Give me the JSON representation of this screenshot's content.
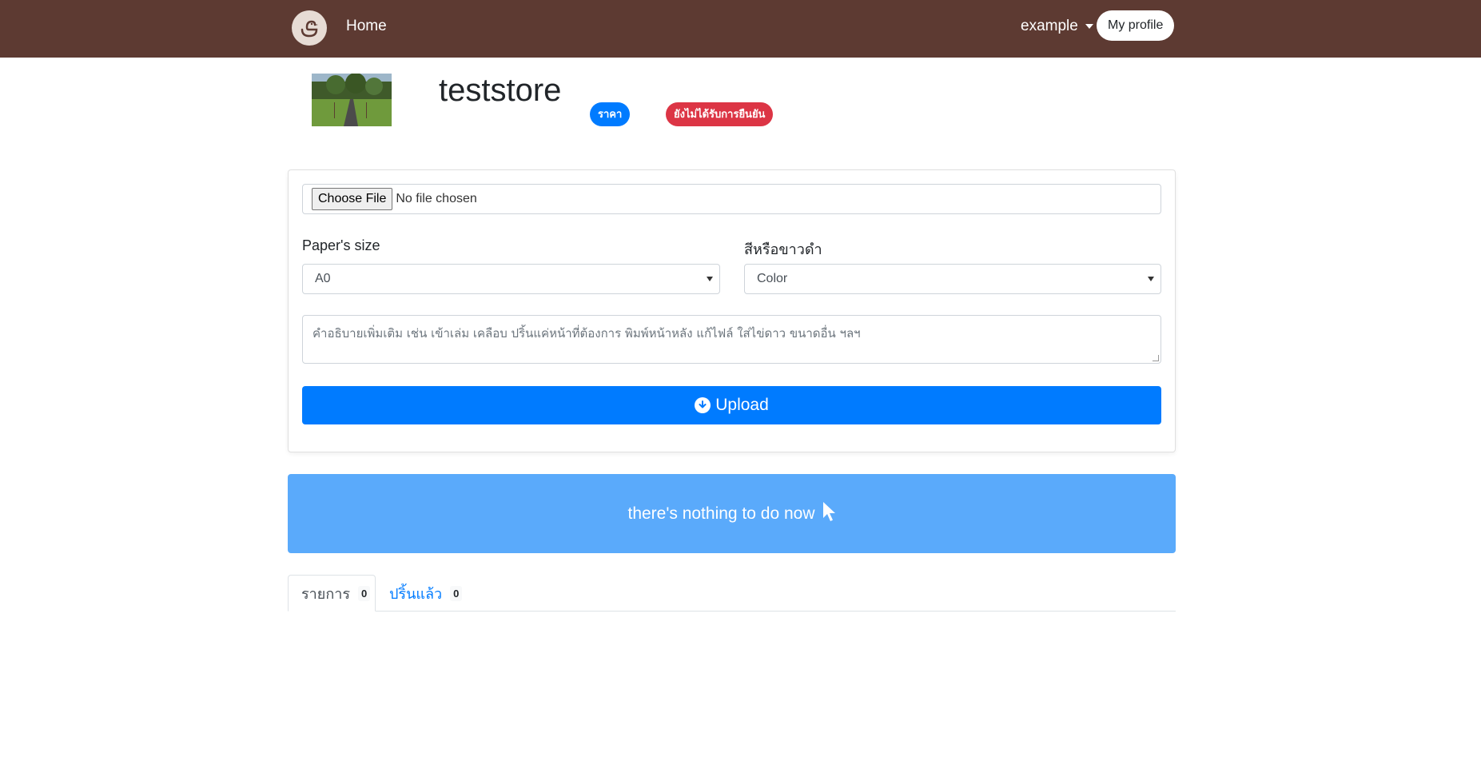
{
  "navbar": {
    "logo_icon": "duck-logo-icon",
    "home_label": "Home",
    "user_label": "example",
    "profile_label": "My profile",
    "background": "#5d3a32"
  },
  "store": {
    "name": "teststore",
    "price_badge": "ราคา",
    "status_badge": "ยังไม่ได้รับการยืนยัน"
  },
  "upload_form": {
    "file_button": "Choose File",
    "file_status": "No file chosen",
    "paper_size_label": "Paper's size",
    "paper_size_value": "A0",
    "color_label": "สีหรือขาวดำ",
    "color_value": "Color",
    "notes_placeholder": "คำอธิบายเพิ่มเติม เช่น เข้าเล่ม เคลือบ ปริ้นแค่หน้าที่ต้องการ พิมพ์หน้าหลัง  แก้ไฟล์ ใส่ไข่ดาว ขนาดอื่น ฯลฯ",
    "upload_label": "Upload",
    "accent": "#007bff"
  },
  "status": {
    "message": "there's nothing to do now",
    "background": "#5aaafb"
  },
  "tabs": [
    {
      "label": "รายการ",
      "count": "0"
    },
    {
      "label": "ปริ้นแล้ว",
      "count": "0"
    }
  ]
}
